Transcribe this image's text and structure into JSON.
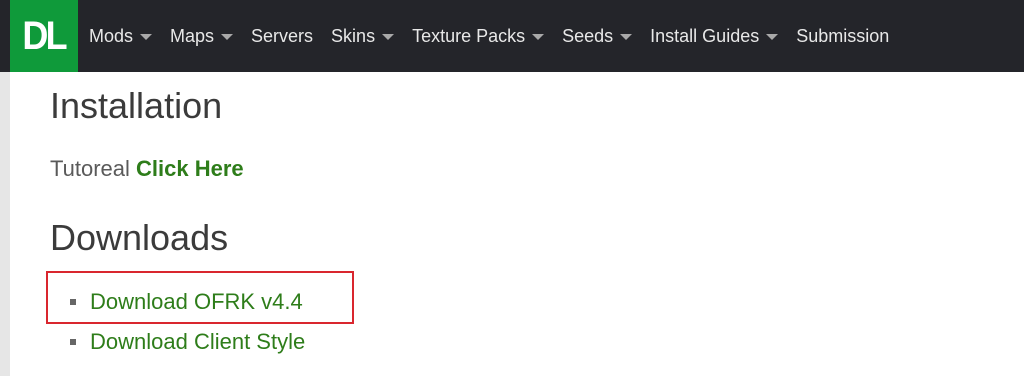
{
  "logo": {
    "text": "DL"
  },
  "nav": {
    "items": [
      {
        "label": "Mods",
        "dropdown": true
      },
      {
        "label": "Maps",
        "dropdown": true
      },
      {
        "label": "Servers",
        "dropdown": false
      },
      {
        "label": "Skins",
        "dropdown": true
      },
      {
        "label": "Texture Packs",
        "dropdown": true
      },
      {
        "label": "Seeds",
        "dropdown": true
      },
      {
        "label": "Install Guides",
        "dropdown": true
      },
      {
        "label": "Submission",
        "dropdown": false
      }
    ]
  },
  "installation": {
    "heading": "Installation",
    "tutorial_prefix": "Tutoreal",
    "tutorial_link": "Click Here"
  },
  "downloads": {
    "heading": "Downloads",
    "items": [
      {
        "label": "Download OFRK v4.4"
      },
      {
        "label": "Download Client Style"
      }
    ]
  },
  "colors": {
    "navbar_bg": "#24252a",
    "logo_bg": "#0f9a3a",
    "link_green": "#2e7d1a",
    "highlight_border": "#d9262e"
  }
}
